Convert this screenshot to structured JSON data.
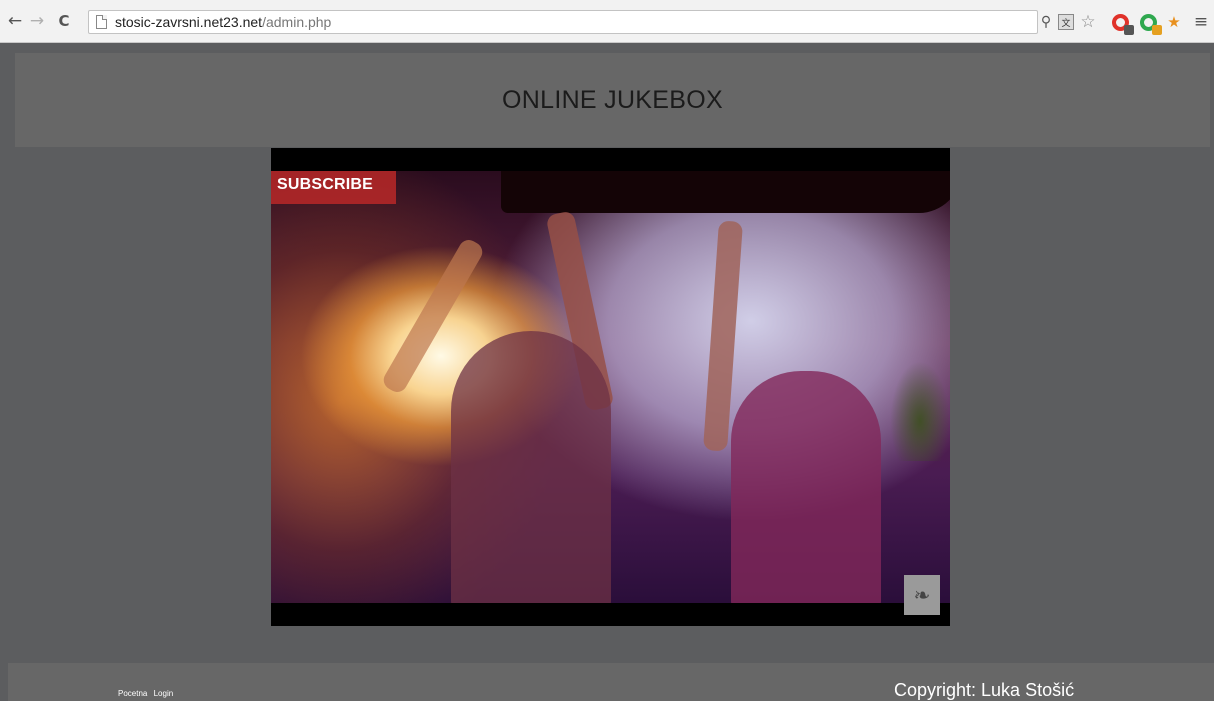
{
  "browser": {
    "url_host": "stosic-zavrsni.net23.net",
    "url_path": "/admin.php",
    "icons": {
      "back": "←",
      "forward": "→",
      "reload": "C",
      "key": "⚲",
      "translate": "文",
      "star": "☆",
      "rocket": "★",
      "menu": "≡"
    }
  },
  "header": {
    "title": "ONLINE JUKEBOX"
  },
  "video": {
    "subscribe_label": "SUBSCRIBE",
    "channel_logo": "❧"
  },
  "footer": {
    "links": [
      "Pocetna",
      "Login"
    ],
    "copyright": "Copyright: Luka Stošić"
  }
}
